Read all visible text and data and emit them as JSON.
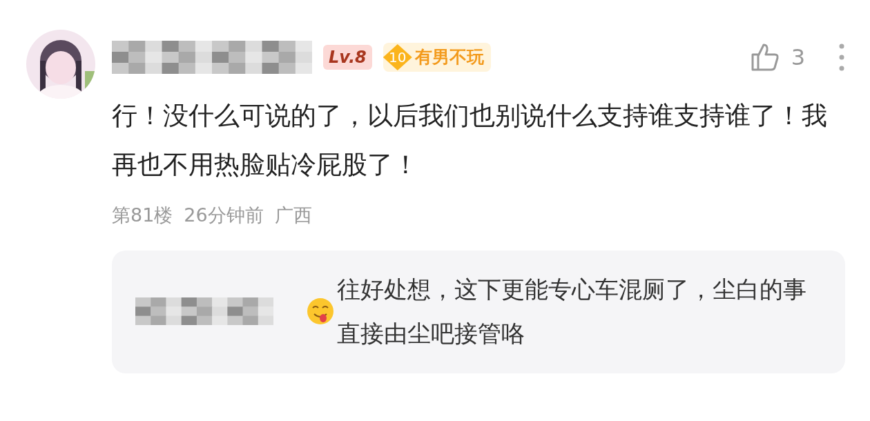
{
  "comment": {
    "level_badge": "Lv.8",
    "medal": {
      "number": "10",
      "title": "有男不玩"
    },
    "likes": "3",
    "text": "行！没什么可说的了，以后我们也别说什么支持谁支持谁了！我再也不用热脸贴冷屁股了！",
    "floor": "第81楼",
    "time": "26分钟前",
    "location": "广西",
    "reply": {
      "text": "往好处想，这下更能专心车混厕了，尘白的事直接由尘吧接管咯"
    }
  }
}
